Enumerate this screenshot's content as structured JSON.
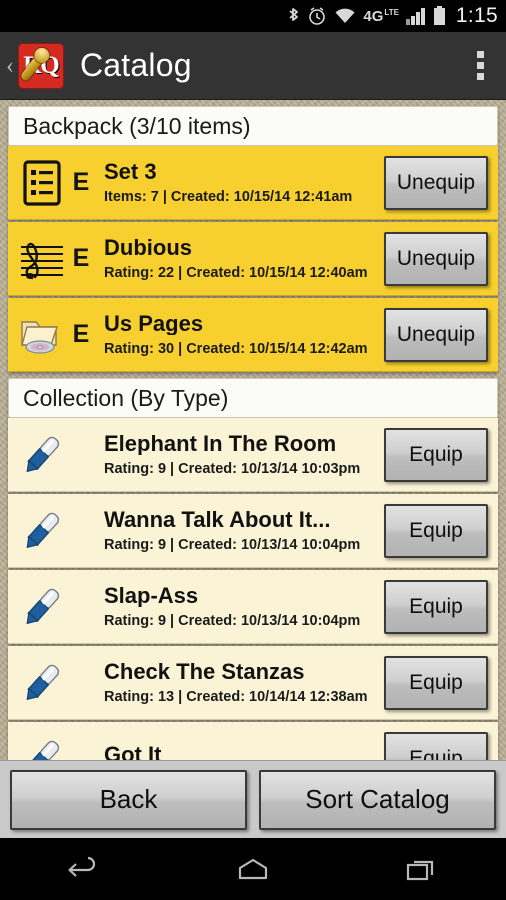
{
  "status_bar": {
    "icons": [
      "bluetooth-icon",
      "alarm-icon",
      "wifi-icon",
      "lte-icon",
      "signal-icon",
      "battery-icon"
    ],
    "network_label": "4G",
    "network_sub": "LTE",
    "clock": "1:15"
  },
  "action_bar": {
    "up_chevron": "‹",
    "app_icon_text": "RQ",
    "title": "Catalog",
    "overflow_name": "overflow-menu"
  },
  "sections": [
    {
      "header": "Backpack (3/10 items)",
      "kind": "equipped",
      "rows": [
        {
          "icon": "list-document-icon",
          "badge": "E",
          "title": "Set 3",
          "subtitle": "Items: 7 | Created: 10/15/14 12:41am",
          "action": "Unequip"
        },
        {
          "icon": "music-staff-icon",
          "badge": "E",
          "title": "Dubious",
          "subtitle": "Rating: 22 | Created: 10/15/14 12:40am",
          "action": "Unequip"
        },
        {
          "icon": "folder-disc-icon",
          "badge": "E",
          "title": "Us Pages",
          "subtitle": "Rating: 30 | Created: 10/15/14 12:42am",
          "action": "Unequip"
        }
      ]
    },
    {
      "header": "Collection (By Type)",
      "kind": "collection",
      "rows": [
        {
          "icon": "pen-icon",
          "badge": "",
          "title": "Elephant In The Room",
          "subtitle": "Rating: 9 | Created: 10/13/14 10:03pm",
          "action": "Equip"
        },
        {
          "icon": "pen-icon",
          "badge": "",
          "title": "Wanna Talk About It...",
          "subtitle": "Rating: 9 | Created: 10/13/14 10:04pm",
          "action": "Equip"
        },
        {
          "icon": "pen-icon",
          "badge": "",
          "title": "Slap-Ass",
          "subtitle": "Rating: 9 | Created: 10/13/14 10:04pm",
          "action": "Equip"
        },
        {
          "icon": "pen-icon",
          "badge": "",
          "title": "Check The Stanzas",
          "subtitle": "Rating: 13 | Created: 10/14/14 12:38am",
          "action": "Equip"
        },
        {
          "icon": "pen-icon",
          "badge": "",
          "title": "Got It",
          "subtitle": "",
          "action": "Equip"
        }
      ]
    }
  ],
  "bottom_bar": {
    "back_label": "Back",
    "sort_label": "Sort Catalog"
  },
  "nav_bar": {
    "back": "nav-back-icon",
    "home": "nav-home-icon",
    "recents": "nav-recents-icon"
  },
  "colors": {
    "equipped_row": "#f7cf2e",
    "collection_row": "#fbf3d6",
    "header_bg": "#fbfbf7",
    "page_bg": "#b8ae93",
    "action_bar": "#333333",
    "app_icon_red": "#d42a20",
    "bottom_bar": "#c9c9c9"
  }
}
